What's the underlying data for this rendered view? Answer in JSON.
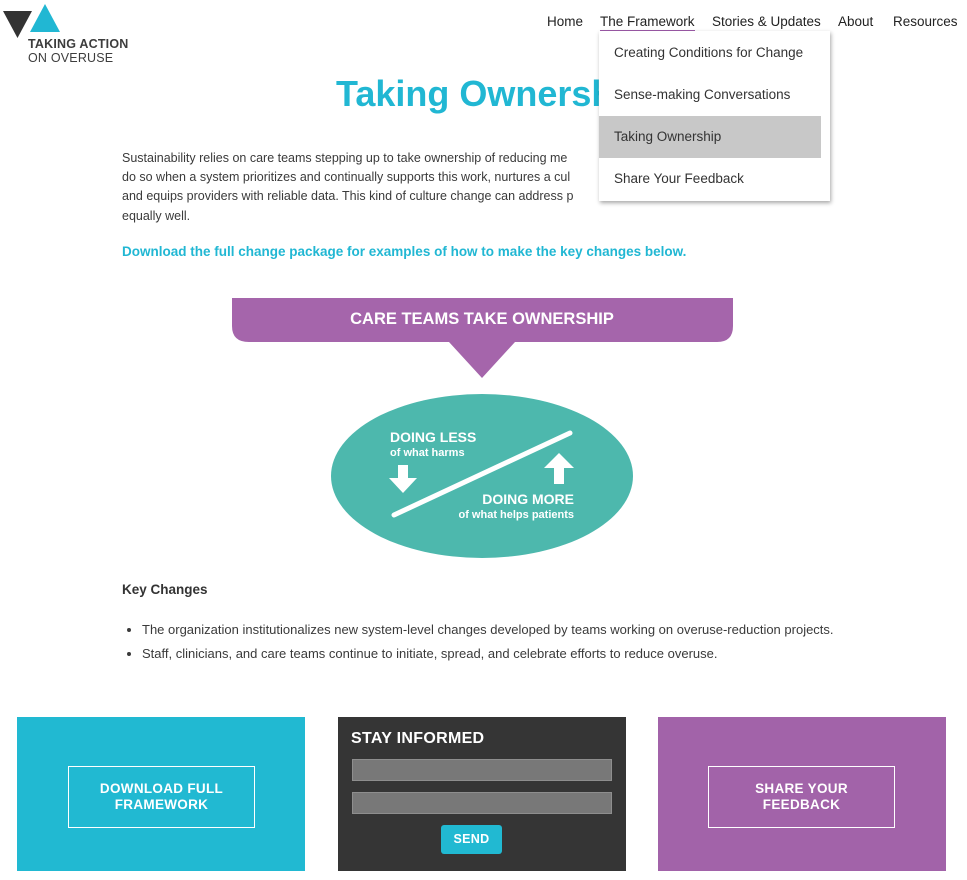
{
  "logo": {
    "line1": "TAKING ACTION",
    "line2": "ON OVERUSE",
    "colors": {
      "dark_triangle": "#333333",
      "light_triangle": "#21b7d3"
    }
  },
  "nav": {
    "items": [
      {
        "label": "Home"
      },
      {
        "label": "The Framework",
        "active": true
      },
      {
        "label": "Stories & Updates"
      },
      {
        "label": "About"
      },
      {
        "label": "Resources"
      }
    ],
    "active_underline_color": "#9d5aa8"
  },
  "dropdown": {
    "items": [
      {
        "label": "Creating Conditions for Change"
      },
      {
        "label": "Sense-making Conversations"
      },
      {
        "label": "Taking Ownership",
        "selected": true
      },
      {
        "label": "Share Your Feedback"
      }
    ]
  },
  "page": {
    "title": "Taking Ownersh",
    "intro_lines": [
      "Sustainability relies on care teams stepping up to take ownership of reducing me",
      "do so when a system prioritizes and continually supports this work, nurtures a cul",
      "and equips providers with reliable data. This kind of culture change can address p",
      "equally well."
    ],
    "download_link": "Download the full change package for examples of how to make the key changes below."
  },
  "graphic": {
    "banner": "CARE TEAMS TAKE OWNERSHIP",
    "doing_less": "DOING LESS",
    "doing_less_sub": "of what harms",
    "doing_more": "DOING MORE",
    "doing_more_sub": "of what helps patients",
    "colors": {
      "banner": "#a565ab",
      "oval": "#4db8ad"
    }
  },
  "key_changes": {
    "title": "Key Changes",
    "items": [
      "The organization institutionalizes new system-level changes developed by teams working on overuse-reduction projects.",
      "Staff, clinicians, and care teams continue to initiate, spread, and celebrate efforts to reduce overuse."
    ]
  },
  "footer": {
    "download_line1": "DOWNLOAD FULL",
    "download_line2": "FRAMEWORK",
    "stay_informed": "STAY INFORMED",
    "field1_placeholder": "",
    "field2_placeholder": "",
    "send": "SEND",
    "feedback_line1": "SHARE YOUR",
    "feedback_line2": "FEEDBACK",
    "colors": {
      "blue": "#21b9d2",
      "dark": "#353535",
      "purple": "#a263a9"
    }
  }
}
